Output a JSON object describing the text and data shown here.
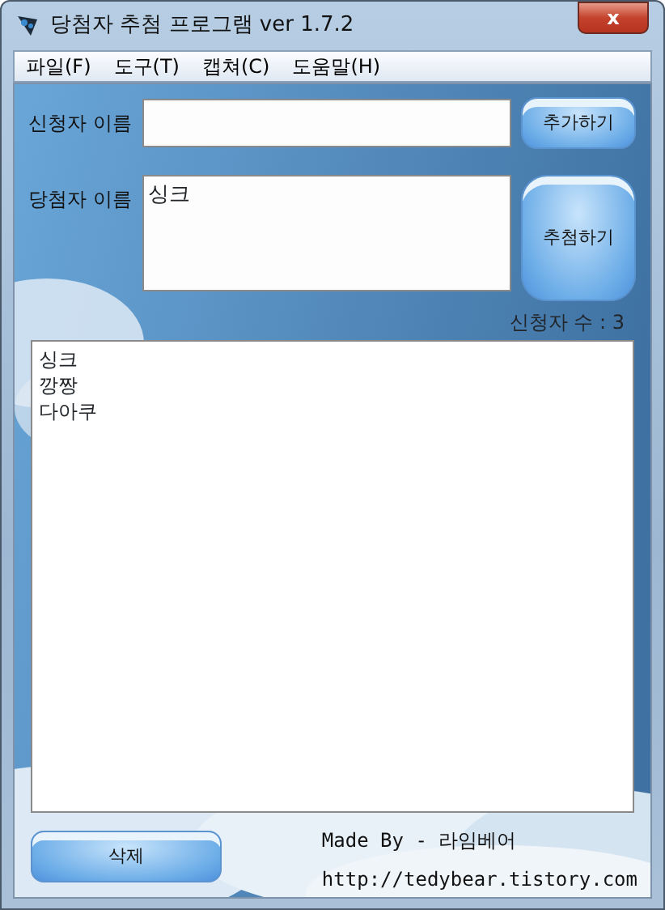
{
  "window": {
    "title": "당첨자 추첨 프로그램 ver 1.7.2",
    "close": "x"
  },
  "menu": [
    "파일(F)",
    "도구(T)",
    "캡쳐(C)",
    "도움말(H)"
  ],
  "applicant": {
    "label": "신청자 이름",
    "button": "추가하기"
  },
  "winner": {
    "label": "당첨자 이름",
    "value": "싱크",
    "button": "추첨하기"
  },
  "count": "신청자 수 : 3",
  "applicants": [
    "싱크",
    "깡짱",
    "다아쿠"
  ],
  "delete_button": "삭제",
  "credit": "Made By - 라임베어",
  "url": "http://tedybear.tistory.com"
}
